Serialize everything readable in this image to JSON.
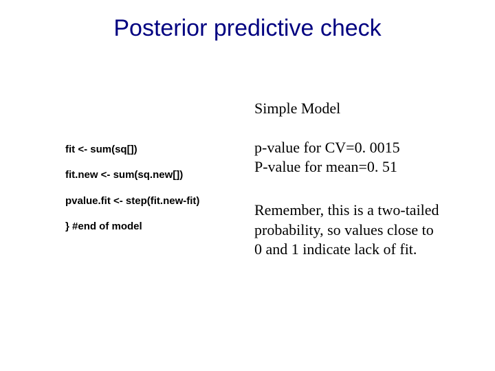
{
  "title": "Posterior predictive check",
  "code": {
    "line1": "fit <- sum(sq[])",
    "line2": "fit.new <- sum(sq.new[])",
    "line3": "pvalue.fit <- step(fit.new-fit)",
    "line4": "} #end of model"
  },
  "right": {
    "heading": "Simple Model",
    "pval_cv": "p-value for CV=0. 0015",
    "pval_mean": "P-value for mean=0. 51",
    "note": "Remember, this is a two-tailed probability, so values close to 0 and 1 indicate lack of fit."
  }
}
